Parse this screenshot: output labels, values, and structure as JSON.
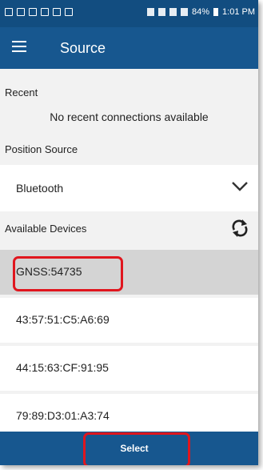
{
  "status_bar": {
    "right_text": "84%",
    "time": "1:01 PM",
    "icons": [
      "notification-icon",
      "notification-icon",
      "image-icon",
      "warning-icon",
      "play-icon",
      "play-icon",
      "location-icon",
      "bluetooth-icon",
      "wifi-icon",
      "signal-icon",
      "battery-icon"
    ]
  },
  "appbar": {
    "title": "Source",
    "menu_icon": "hamburger-menu-icon"
  },
  "recent": {
    "label": "Recent",
    "empty_message": "No recent connections available"
  },
  "position_source": {
    "label": "Position Source",
    "value": "Bluetooth",
    "dropdown_icon": "chevron-down-icon"
  },
  "available_devices": {
    "label": "Available Devices",
    "refresh_icon": "refresh-icon",
    "devices": [
      {
        "name": "GNSS:54735",
        "selected": true
      },
      {
        "name": "43:57:51:C5:A6:69",
        "selected": false
      },
      {
        "name": "44:15:63:CF:91:95",
        "selected": false
      },
      {
        "name": "79:89:D3:01:A3:74",
        "selected": false
      }
    ]
  },
  "footer": {
    "select_label": "Select"
  },
  "colors": {
    "appbar": "#17578f",
    "statusbar": "#124d80",
    "highlight": "#e0161e",
    "selected_row": "#d4d4d4"
  }
}
